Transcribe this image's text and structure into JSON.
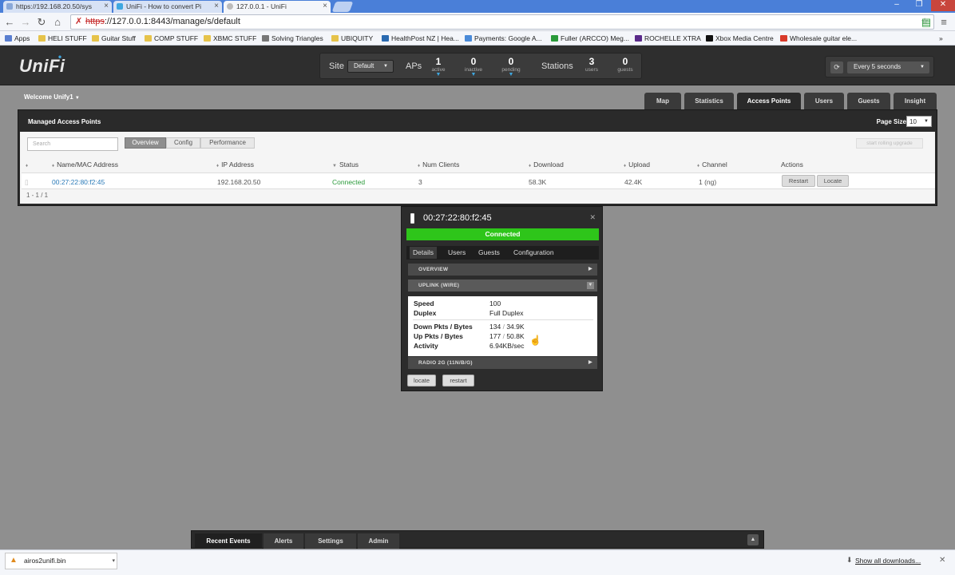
{
  "browser": {
    "tabs": [
      {
        "label": "https://192.168.20.50/sys",
        "active": false
      },
      {
        "label": "UniFi - How to convert Pi",
        "active": false
      },
      {
        "label": "127.0.0.1 - UniFi",
        "active": true
      }
    ],
    "address": {
      "scheme": "https",
      "rest": "://127.0.0.1:8443/manage/s/default"
    },
    "bookmarks": [
      {
        "label": "Apps",
        "color": "#5a7fd0"
      },
      {
        "label": "HELI STUFF",
        "color": "#e6c34a"
      },
      {
        "label": "Guitar Stuff",
        "color": "#e6c34a"
      },
      {
        "label": "COMP STUFF",
        "color": "#e6c34a"
      },
      {
        "label": "XBMC STUFF",
        "color": "#e6c34a"
      },
      {
        "label": "Solving Triangles",
        "color": "#777777"
      },
      {
        "label": "UBIQUITY",
        "color": "#e6c34a"
      },
      {
        "label": "HealthPost NZ | Hea...",
        "color": "#2a6ab0"
      },
      {
        "label": "Payments: Google A...",
        "color": "#4a8ad8"
      },
      {
        "label": "Fuller (ARCCO) Meg...",
        "color": "#2a9a3a"
      },
      {
        "label": "ROCHELLE XTRA",
        "color": "#5a2a8a"
      },
      {
        "label": "Xbox Media Centre",
        "color": "#111111"
      },
      {
        "label": "Wholesale guitar ele...",
        "color": "#d83a2a"
      }
    ]
  },
  "header": {
    "logo": "UniFi",
    "site_label": "Site",
    "site_value": "Default",
    "aps_label": "APs",
    "stations_label": "Stations",
    "stats": [
      {
        "n": "1",
        "s": "active"
      },
      {
        "n": "0",
        "s": "inactive"
      },
      {
        "n": "0",
        "s": "pending"
      },
      {
        "n": "3",
        "s": "users"
      },
      {
        "n": "0",
        "s": "guests"
      }
    ],
    "refresh_value": "Every 5 seconds"
  },
  "welcome": "Welcome Unify1",
  "nav": [
    "Map",
    "Statistics",
    "Access Points",
    "Users",
    "Guests",
    "Insight"
  ],
  "panel": {
    "title": "Managed Access Points",
    "page_size_label": "Page Size",
    "page_size_value": "10",
    "search_placeholder": "Search",
    "view_tabs": [
      "Overview",
      "Config",
      "Performance"
    ],
    "rolling_upgrade": "start rolling upgrade",
    "columns": [
      "Name/MAC Address",
      "IP Address",
      "Status",
      "Num Clients",
      "Download",
      "Upload",
      "Channel",
      "Actions"
    ],
    "row": {
      "name": "00:27:22:80:f2:45",
      "ip": "192.168.20.50",
      "status": "Connected",
      "clients": "3",
      "download": "58.3K",
      "upload": "42.4K",
      "channel": "1 (ng)",
      "restart": "Restart",
      "locate": "Locate"
    },
    "pager": "1 - 1 / 1"
  },
  "popup": {
    "title": "00:27:22:80:f2:45",
    "status": "Connected",
    "tabs": [
      "Details",
      "Users",
      "Guests",
      "Configuration"
    ],
    "sections": {
      "overview": "OVERVIEW",
      "uplink": "UPLINK (WIRE)",
      "radio": "RADIO 2G (11N/B/G)"
    },
    "speed_label": "Speed",
    "speed": "100",
    "duplex_label": "Duplex",
    "duplex": "Full Duplex",
    "down_label": "Down Pkts / Bytes",
    "down_pkts": "134",
    "down_bytes": "34.9K",
    "up_label": "Up Pkts / Bytes",
    "up_pkts": "177",
    "up_bytes": "50.8K",
    "activity_label": "Activity",
    "activity": "6.94KB/sec",
    "locate": "locate",
    "restart": "restart"
  },
  "bottom": [
    "Recent Events",
    "Alerts",
    "Settings",
    "Admin"
  ],
  "downloads": {
    "file": "airos2unifi.bin",
    "show_all": "Show all downloads..."
  },
  "colors": {
    "connected": "#2ec51a",
    "accent": "#3ea7e0"
  }
}
